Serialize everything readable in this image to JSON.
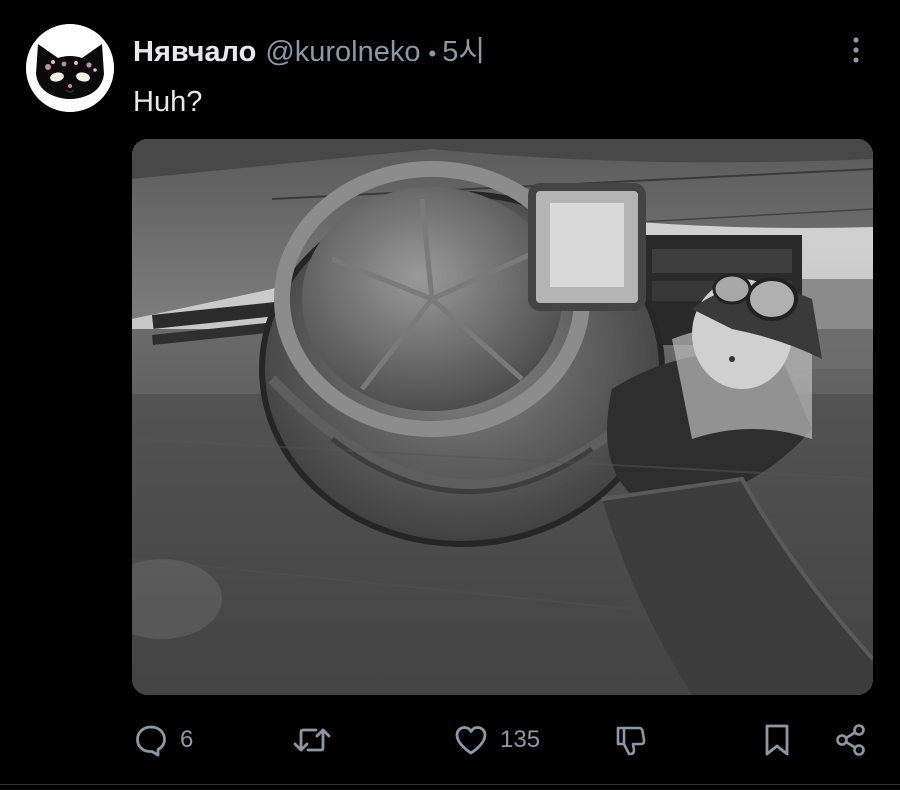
{
  "post": {
    "author": {
      "display_name": "Нявчало",
      "handle": "@kurolneko",
      "separator": "•",
      "timestamp": "5시",
      "avatar_icon": "black-cat-mask-avatar"
    },
    "text": "Huh?",
    "media": {
      "type": "photo",
      "kind": "black-and-white photograph"
    },
    "actions": {
      "reply_count": "6",
      "repost_count": "",
      "like_count": "135"
    }
  },
  "colors": {
    "background": "#000000",
    "primary_text": "#e7e9ea",
    "secondary_text": "#8b98a5"
  }
}
